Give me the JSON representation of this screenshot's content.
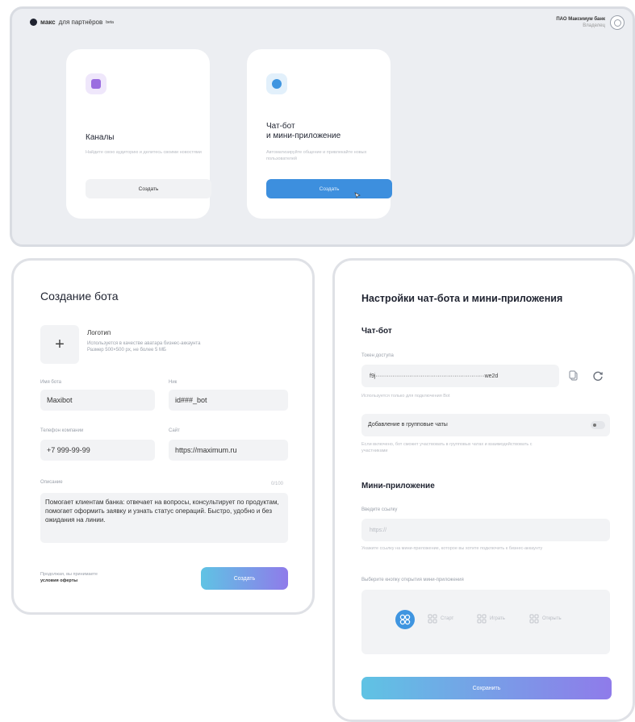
{
  "header": {
    "logo_word": "макс",
    "logo_suffix": "для партнёров",
    "logo_badge": "beta",
    "user_name": "ПАО Максимум банк",
    "user_role": "Владелец"
  },
  "cards": [
    {
      "title": "Каналы",
      "description": "Найдите свою аудиторию и делитесь своими новостями",
      "button": "Создать",
      "icon": "megaphone-icon"
    },
    {
      "title_line1": "Чат-бот",
      "title_line2": "и мини-приложение",
      "description": "Автоматизируйте общение и привлекайте новых пользователей",
      "button": "Создать",
      "icon": "chat-bubble-icon"
    }
  ],
  "bot_form": {
    "title": "Создание бота",
    "logo_label": "Логотип",
    "logo_hint_1": "Используется в качестве аватара бизнес-аккаунта",
    "logo_hint_2": "Размер 500×500 px, не более 5 МБ",
    "name_label": "Имя бота",
    "name_value": "Maxibot",
    "nick_label": "Ник",
    "nick_value": "id###_bot",
    "phone_label": "Телефон компании",
    "phone_value": "+7 999-99-99",
    "site_label": "Сайт",
    "site_value": "https://maximum.ru",
    "desc_label": "Описание",
    "desc_count": "0/100",
    "desc_value": "Помогает клиентам банка: отвечает на вопросы, консультирует по продуктам, помогает оформить заявку и узнать статус операций. Быстро, удобно и без ожидания на линии.",
    "terms_line1": "Продолжая, вы принимаете",
    "terms_line2": "условия оферты",
    "submit": "Создать"
  },
  "settings": {
    "title": "Настройки чат-бота и мини-приложения",
    "chatbot_heading": "Чат-бот",
    "token_label": "Токен доступа",
    "token_value": "f9j··························································we2d",
    "token_hint": "Используется только для подключения Bot",
    "group_label": "Добавление в групповые чаты",
    "group_hint": "Если включено, бот сможет участвовать в групповых чатах и взаимодействовать с участниками",
    "mini_heading": "Мини-приложение",
    "link_label": "Введите ссылку",
    "link_placeholder": "https://",
    "link_hint": "Укажите ссылку на мини-приложение, которое вы хотите подключить к бизнес-аккаунту",
    "open_label": "Выберите кнопку открытия мини-приложения",
    "options": [
      "Старт",
      "Играть",
      "Открыть"
    ],
    "save": "Сохранить"
  },
  "colors": {
    "accent_blue": "#3d8fde",
    "gradient_start": "#5fc3e4",
    "gradient_end": "#8f7bea"
  }
}
